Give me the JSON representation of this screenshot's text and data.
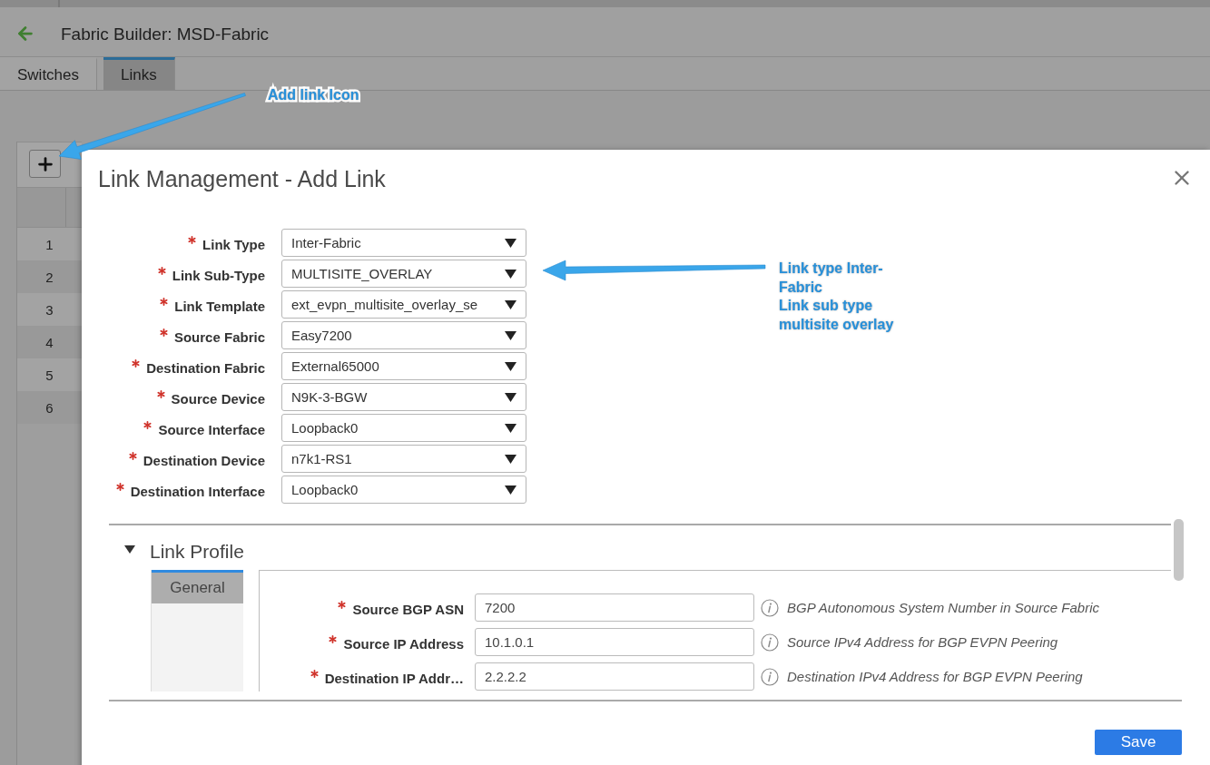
{
  "page": {
    "title": "Fabric Builder: MSD-Fabric"
  },
  "tabs": [
    {
      "label": "Switches",
      "selected": false
    },
    {
      "label": "Links",
      "selected": true
    }
  ],
  "table": {
    "rows": [
      {
        "number": "1"
      },
      {
        "number": "2"
      },
      {
        "number": "3"
      },
      {
        "number": "4"
      },
      {
        "number": "5"
      },
      {
        "number": "6"
      }
    ]
  },
  "dialog": {
    "title": "Link Management - Add Link",
    "fields": [
      {
        "label": "Link Type",
        "required": true,
        "value": "Inter-Fabric"
      },
      {
        "label": "Link Sub-Type",
        "required": true,
        "value": "MULTISITE_OVERLAY"
      },
      {
        "label": "Link Template",
        "required": true,
        "value": "ext_evpn_multisite_overlay_se"
      },
      {
        "label": "Source Fabric",
        "required": true,
        "value": "Easy7200"
      },
      {
        "label": "Destination Fabric",
        "required": true,
        "value": "External65000"
      },
      {
        "label": "Source Device",
        "required": true,
        "value": "N9K-3-BGW"
      },
      {
        "label": "Source Interface",
        "required": true,
        "value": "Loopback0"
      },
      {
        "label": "Destination Device",
        "required": true,
        "value": "n7k1-RS1"
      },
      {
        "label": "Destination Interface",
        "required": true,
        "value": "Loopback0"
      }
    ],
    "link_profile": {
      "title": "Link Profile",
      "expanded": true,
      "tabs": [
        {
          "label": "General",
          "selected": true
        }
      ],
      "fields": [
        {
          "label": "Source BGP ASN",
          "required": true,
          "value": "7200",
          "description": "BGP Autonomous System Number in Source Fabric"
        },
        {
          "label": "Source IP Address",
          "required": true,
          "value": "10.1.0.1",
          "description": "Source IPv4 Address for BGP EVPN Peering"
        },
        {
          "label": "Destination IP Addr…",
          "required": true,
          "value": "2.2.2.2",
          "description": "Destination IPv4 Address for BGP EVPN Peering"
        }
      ]
    },
    "buttons": [
      {
        "label": "Save"
      }
    ]
  },
  "annotations": [
    {
      "kind": "callout",
      "lines": [
        "Add link Icon"
      ]
    },
    {
      "kind": "callout",
      "lines": [
        "Link type Inter-Fabric",
        "Link sub type multisite overlay"
      ]
    }
  ]
}
